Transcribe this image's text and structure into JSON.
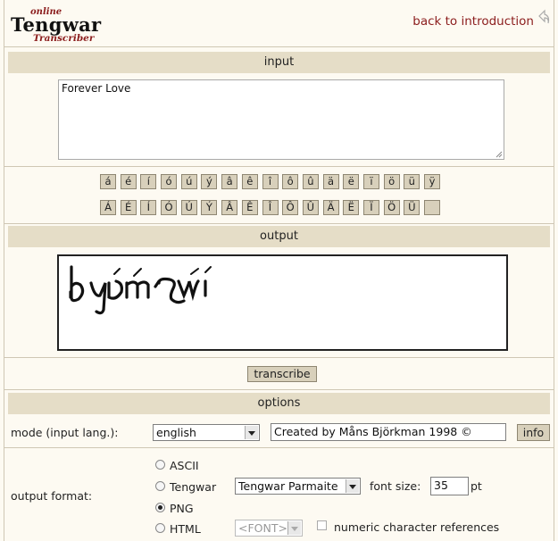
{
  "header": {
    "logo_top": "online",
    "logo_main": "Tengwar",
    "logo_bottom": "Transcriber",
    "back_link": "back to introduction"
  },
  "input_section": {
    "title": "input",
    "text": "Forever Love"
  },
  "keyboard": {
    "row1": [
      "á",
      "é",
      "í",
      "ó",
      "ú",
      "ý",
      "â",
      "ê",
      "î",
      "ô",
      "û",
      "ä",
      "ë",
      "ï",
      "ö",
      "ü",
      "ÿ"
    ],
    "row2": [
      "Á",
      "É",
      "Í",
      "Ó",
      "Ú",
      "Ý",
      "Â",
      "Ê",
      "Î",
      "Ô",
      "Û",
      "Ä",
      "Ë",
      "Ï",
      "Ö",
      "Ü",
      ""
    ]
  },
  "output_section": {
    "title": "output"
  },
  "transcribe_label": "transcribe",
  "options": {
    "title": "options",
    "mode_label": "mode (input lang.):",
    "mode_value": "english",
    "mode_info_text": "Created by Måns Björkman 1998 ©",
    "info_label": "info",
    "output_format_label": "output format:",
    "formats": [
      {
        "label": "ASCII",
        "selected": false
      },
      {
        "label": "Tengwar",
        "selected": false
      },
      {
        "label": "PNG",
        "selected": true
      },
      {
        "label": "HTML",
        "selected": false
      }
    ],
    "font_value": "Tengwar Parmaite",
    "font_size_label": "font size:",
    "font_size_value": "35",
    "font_size_unit": "pt",
    "html_font_value": "<FONT>",
    "numeric_refs_label": "numeric character references"
  }
}
